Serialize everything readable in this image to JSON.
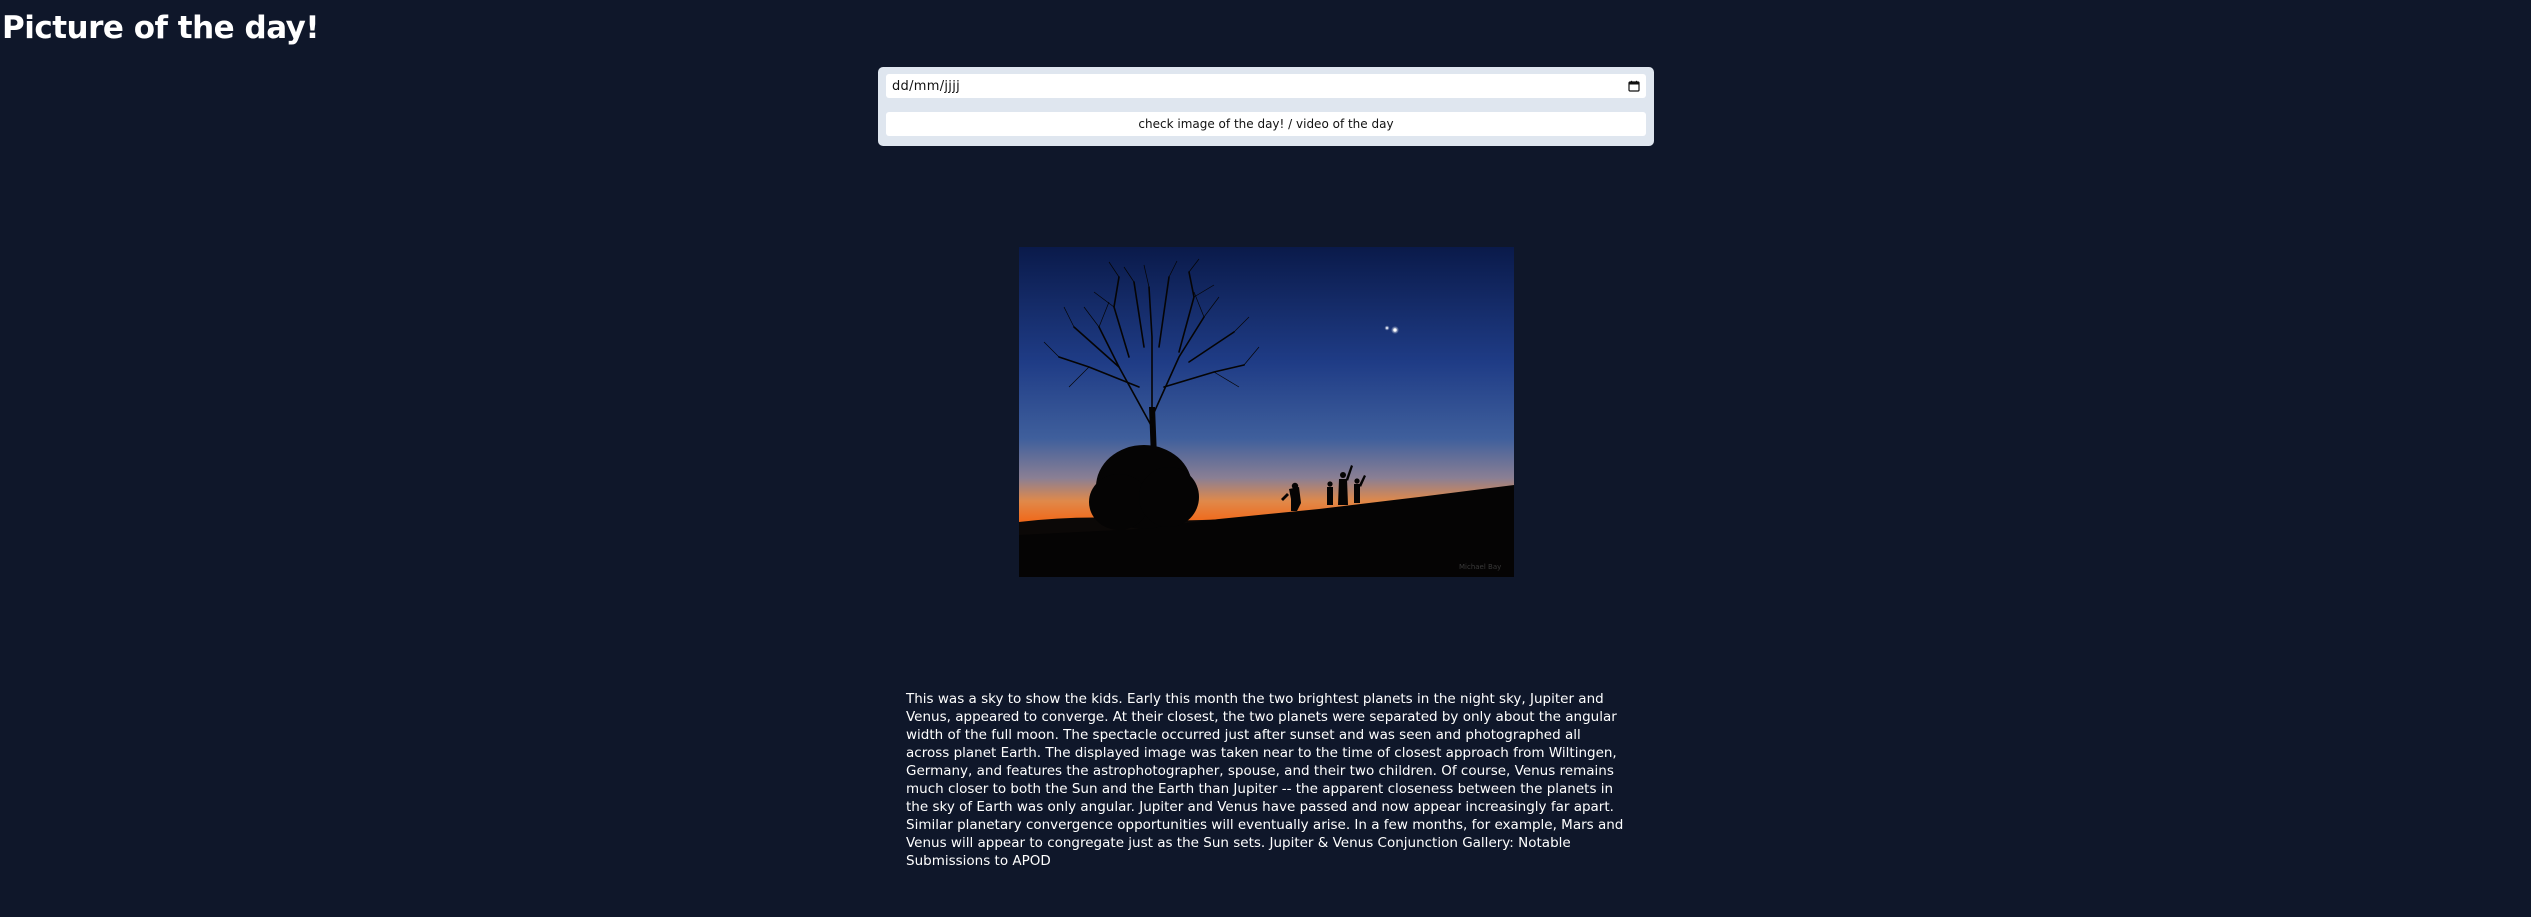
{
  "page": {
    "title": "Picture of the day!"
  },
  "form": {
    "date_placeholder": "dd/mm/jjjj",
    "submit_label": "check image of the day! / video of the day"
  },
  "apod": {
    "explanation": "This was a sky to show the kids. Early this month the two brightest planets in the night sky, Jupiter and Venus, appeared to converge. At their closest, the two planets were separated by only about the angular width of the full moon. The spectacle occurred just after sunset and was seen and photographed all across planet Earth. The displayed image was taken near to the time of closest approach from Wiltingen, Germany, and features the astrophotographer, spouse, and their two children. Of course, Venus remains much closer to both the Sun and the Earth than Jupiter -- the apparent closeness between the planets in the sky of Earth was only angular. Jupiter and Venus have passed and now appear increasingly far apart. Similar planetary convergence opportunities will eventually arise. In a few months, for example, Mars and Venus will appear to congregate just as the Sun sets. Jupiter & Venus Conjunction Gallery: Notable Submissions to APOD",
    "image_credit": "Michael Bay"
  },
  "colors": {
    "background": "#0f172a",
    "card": "#dfe6ef",
    "text": "#ffffff"
  },
  "icons": {
    "date_picker": "calendar-icon"
  }
}
